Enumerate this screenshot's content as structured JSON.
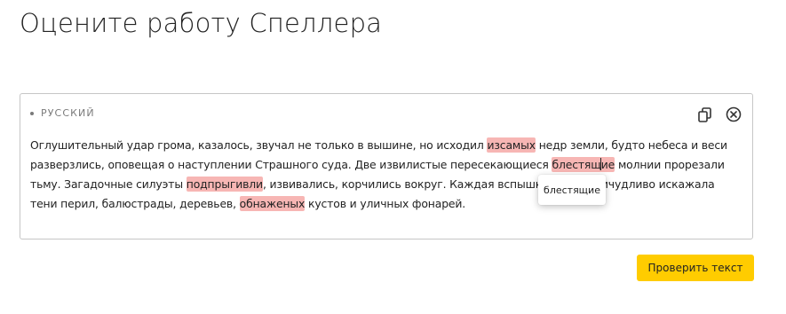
{
  "page": {
    "title": "Оцените работу Спеллера"
  },
  "editor": {
    "language": "РУССКИЙ",
    "toolbar": {
      "copy_icon": "copy-icon",
      "clear_icon": "close-circle-icon"
    },
    "text": {
      "p1": "Оглушительный удар грома, казалось, звучал не только в вышине, но исходил ",
      "err1": "изсамых",
      "p2": " недр земли, будто небеса и веси разверзлись, оповещая о наступлении Страшного суда. Две извилистые пересекающиеся ",
      "err2a": "блестящ",
      "err2b": "ие",
      "p3": " молнии прорезали тьму. Загадочные силуэты ",
      "err3": "подпрыгивли",
      "p4": ", извивались, корчились вокруг. Каждая вспышка столь причудливо искажала тени перил, балюстрады, деревьев, ",
      "err4": "обнаженых",
      "p5": " кустов и уличных фонарей."
    },
    "suggestion_popup": {
      "item": "блестящие"
    }
  },
  "actions": {
    "check_label": "Проверить текст"
  },
  "colors": {
    "accent": "#ffcc00",
    "error_highlight": "#f7b6b4",
    "border": "#c6c6c6",
    "muted_text": "#7a7a7a"
  }
}
